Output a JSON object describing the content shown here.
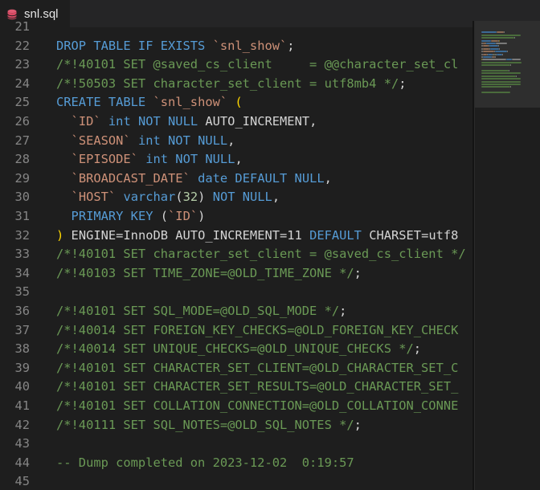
{
  "tab": {
    "filename": "snl.sql"
  },
  "lines": [
    {
      "n": "21",
      "tokens": []
    },
    {
      "n": "22",
      "tokens": [
        [
          "kw",
          "DROP TABLE IF EXISTS "
        ],
        [
          "st",
          "`snl_show`"
        ],
        [
          "tx",
          ";"
        ]
      ]
    },
    {
      "n": "23",
      "tokens": [
        [
          "cm",
          "/*!40101 SET @saved_cs_client     = @@character_set_cl"
        ]
      ]
    },
    {
      "n": "24",
      "tokens": [
        [
          "cm",
          "/*!50503 SET character_set_client = utf8mb4 */"
        ],
        [
          "tx",
          ";"
        ]
      ]
    },
    {
      "n": "25",
      "tokens": [
        [
          "kw",
          "CREATE TABLE "
        ],
        [
          "st",
          "`snl_show`"
        ],
        [
          "tx",
          " "
        ],
        [
          "br",
          "("
        ]
      ]
    },
    {
      "n": "26",
      "tokens": [
        [
          "tx",
          "  "
        ],
        [
          "st",
          "`ID`"
        ],
        [
          "tx",
          " "
        ],
        [
          "kw",
          "int NOT NULL "
        ],
        [
          "tx",
          "AUTO_INCREMENT,"
        ]
      ]
    },
    {
      "n": "27",
      "tokens": [
        [
          "tx",
          "  "
        ],
        [
          "st",
          "`SEASON`"
        ],
        [
          "tx",
          " "
        ],
        [
          "kw",
          "int NOT NULL"
        ],
        [
          "tx",
          ","
        ]
      ]
    },
    {
      "n": "28",
      "tokens": [
        [
          "tx",
          "  "
        ],
        [
          "st",
          "`EPISODE`"
        ],
        [
          "tx",
          " "
        ],
        [
          "kw",
          "int NOT NULL"
        ],
        [
          "tx",
          ","
        ]
      ]
    },
    {
      "n": "29",
      "tokens": [
        [
          "tx",
          "  "
        ],
        [
          "st",
          "`BROADCAST_DATE`"
        ],
        [
          "tx",
          " "
        ],
        [
          "kw",
          "date DEFAULT NULL"
        ],
        [
          "tx",
          ","
        ]
      ]
    },
    {
      "n": "30",
      "tokens": [
        [
          "tx",
          "  "
        ],
        [
          "st",
          "`HOST`"
        ],
        [
          "tx",
          " "
        ],
        [
          "kw",
          "varchar"
        ],
        [
          "tx",
          "("
        ],
        [
          "nu",
          "32"
        ],
        [
          "tx",
          ") "
        ],
        [
          "kw",
          "NOT NULL"
        ],
        [
          "tx",
          ","
        ]
      ]
    },
    {
      "n": "31",
      "tokens": [
        [
          "tx",
          "  "
        ],
        [
          "kw",
          "PRIMARY KEY "
        ],
        [
          "tx",
          "("
        ],
        [
          "st",
          "`ID`"
        ],
        [
          "tx",
          ")"
        ]
      ]
    },
    {
      "n": "32",
      "tokens": [
        [
          "br",
          ")"
        ],
        [
          "tx",
          " ENGINE=InnoDB AUTO_INCREMENT=11 "
        ],
        [
          "kw",
          "DEFAULT "
        ],
        [
          "tx",
          "CHARSET=utf8"
        ]
      ]
    },
    {
      "n": "33",
      "tokens": [
        [
          "cm",
          "/*!40101 SET character_set_client = @saved_cs_client */"
        ]
      ]
    },
    {
      "n": "34",
      "tokens": [
        [
          "cm",
          "/*!40103 SET TIME_ZONE=@OLD_TIME_ZONE */"
        ],
        [
          "tx",
          ";"
        ]
      ]
    },
    {
      "n": "35",
      "tokens": []
    },
    {
      "n": "36",
      "tokens": [
        [
          "cm",
          "/*!40101 SET SQL_MODE=@OLD_SQL_MODE */"
        ],
        [
          "tx",
          ";"
        ]
      ]
    },
    {
      "n": "37",
      "tokens": [
        [
          "cm",
          "/*!40014 SET FOREIGN_KEY_CHECKS=@OLD_FOREIGN_KEY_CHECK"
        ]
      ]
    },
    {
      "n": "38",
      "tokens": [
        [
          "cm",
          "/*!40014 SET UNIQUE_CHECKS=@OLD_UNIQUE_CHECKS */"
        ],
        [
          "tx",
          ";"
        ]
      ]
    },
    {
      "n": "39",
      "tokens": [
        [
          "cm",
          "/*!40101 SET CHARACTER_SET_CLIENT=@OLD_CHARACTER_SET_C"
        ]
      ]
    },
    {
      "n": "40",
      "tokens": [
        [
          "cm",
          "/*!40101 SET CHARACTER_SET_RESULTS=@OLD_CHARACTER_SET_"
        ]
      ]
    },
    {
      "n": "41",
      "tokens": [
        [
          "cm",
          "/*!40101 SET COLLATION_CONNECTION=@OLD_COLLATION_CONNE"
        ]
      ]
    },
    {
      "n": "42",
      "tokens": [
        [
          "cm",
          "/*!40111 SET SQL_NOTES=@OLD_SQL_NOTES */"
        ],
        [
          "tx",
          ";"
        ]
      ]
    },
    {
      "n": "43",
      "tokens": []
    },
    {
      "n": "44",
      "tokens": [
        [
          "cm",
          "-- Dump completed on 2023-12-02  0:19:57"
        ]
      ]
    },
    {
      "n": "45",
      "tokens": []
    }
  ],
  "icons": {
    "tab_icon": "database-icon"
  }
}
